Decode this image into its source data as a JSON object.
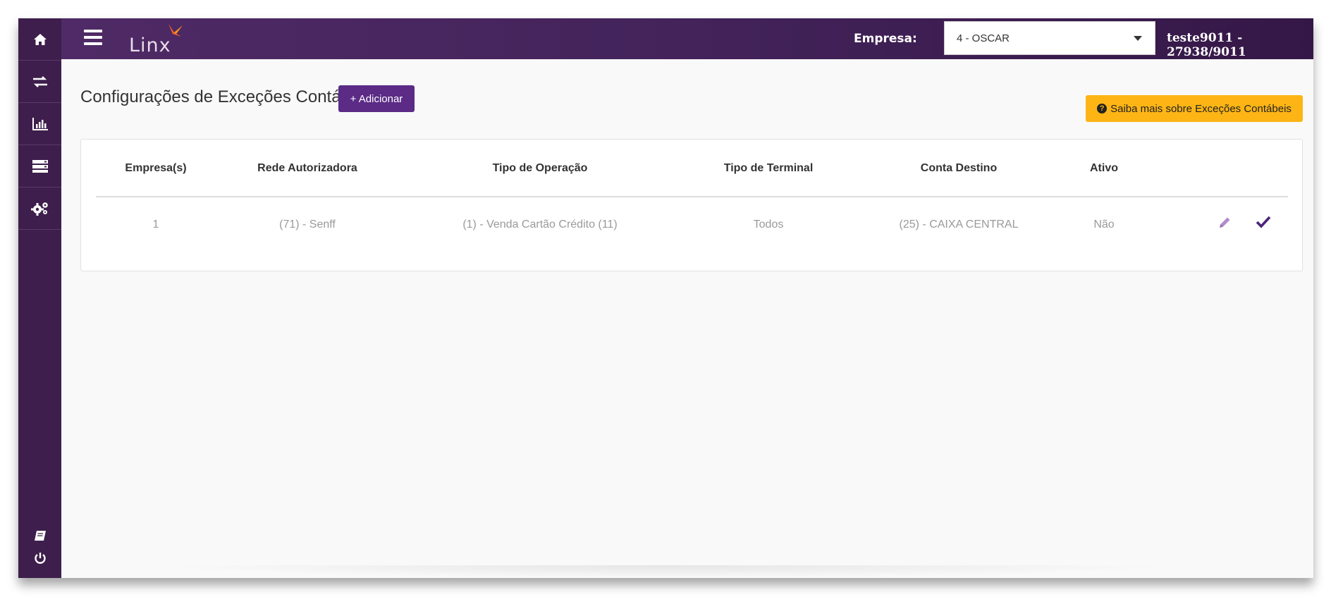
{
  "sidebar": {
    "items": [
      {
        "icon": "home-icon"
      },
      {
        "icon": "transfer-icon"
      },
      {
        "icon": "bar-chart-icon"
      },
      {
        "icon": "server-icon"
      },
      {
        "icon": "gears-icon"
      }
    ],
    "bottom": [
      {
        "icon": "book-icon"
      },
      {
        "icon": "power-icon"
      }
    ]
  },
  "topbar": {
    "logo_text": "Linx",
    "empresa_label": "Empresa:",
    "empresa_value": "4 - OSCAR",
    "user_info": "teste9011 - 27938/9011"
  },
  "page": {
    "title": "Configurações de Exceções Contábeis",
    "add_button": "+ Adicionar",
    "info_button": "Saiba mais sobre Exceções Contábeis"
  },
  "table": {
    "columns": [
      "Empresa(s)",
      "Rede Autorizadora",
      "Tipo de Operação",
      "Tipo de Terminal",
      "Conta Destino",
      "Ativo"
    ],
    "rows": [
      [
        "1",
        "(71) - Senff",
        "(1) - Venda Cartão Crédito (11)",
        "Todos",
        "(25) - CAIXA CENTRAL",
        "Não"
      ]
    ]
  },
  "colors": {
    "sidebar": "#3e1e4c",
    "topbar": "#4f2a66",
    "primary_button": "#5b2b86",
    "info_button": "#fdb515",
    "logo_accent": "#f26522"
  }
}
